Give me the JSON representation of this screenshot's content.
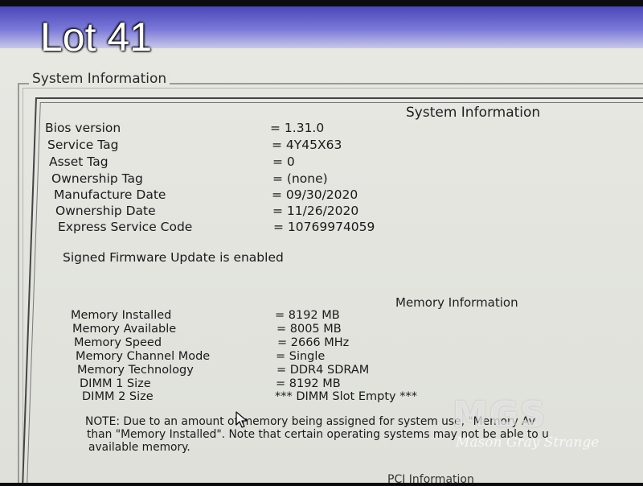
{
  "overlay": {
    "lot_label": "Lot 41"
  },
  "window": {
    "title": "System Information"
  },
  "system": {
    "heading": "System Information",
    "rows": [
      {
        "label": "Bios version",
        "value": "= 1.31.0"
      },
      {
        "label": "Service Tag",
        "value": "= 4Y45X63"
      },
      {
        "label": "Asset Tag",
        "value": "= 0"
      },
      {
        "label": "Ownership Tag",
        "value": "= (none)"
      },
      {
        "label": "Manufacture Date",
        "value": "= 09/30/2020"
      },
      {
        "label": "Ownership Date",
        "value": "= 11/26/2020"
      },
      {
        "label": "Express Service Code",
        "value": "= 10769974059"
      }
    ],
    "firmware_status": "Signed Firmware Update is enabled"
  },
  "memory": {
    "heading": "Memory Information",
    "rows": [
      {
        "label": "Memory Installed",
        "value": "= 8192 MB"
      },
      {
        "label": "Memory Available",
        "value": "= 8005 MB"
      },
      {
        "label": "Memory Speed",
        "value": "= 2666 MHz"
      },
      {
        "label": "Memory Channel Mode",
        "value": "= Single"
      },
      {
        "label": "Memory Technology",
        "value": "= DDR4 SDRAM"
      },
      {
        "label": "DIMM 1 Size",
        "value": "= 8192 MB"
      },
      {
        "label": "DIMM 2 Size",
        "value": "*** DIMM Slot Empty ***"
      }
    ],
    "note_lines": [
      "NOTE: Due to an amount of memory being assigned for system use, \"Memory Av",
      "than \"Memory Installed\". Note that certain operating systems may not be able to u",
      "available memory."
    ]
  },
  "pci": {
    "heading": "PCI Information"
  },
  "watermark": {
    "logo": "MGS",
    "text": "Mason Gray Strange"
  },
  "icons": {
    "cursor": "mouse-pointer-icon"
  }
}
